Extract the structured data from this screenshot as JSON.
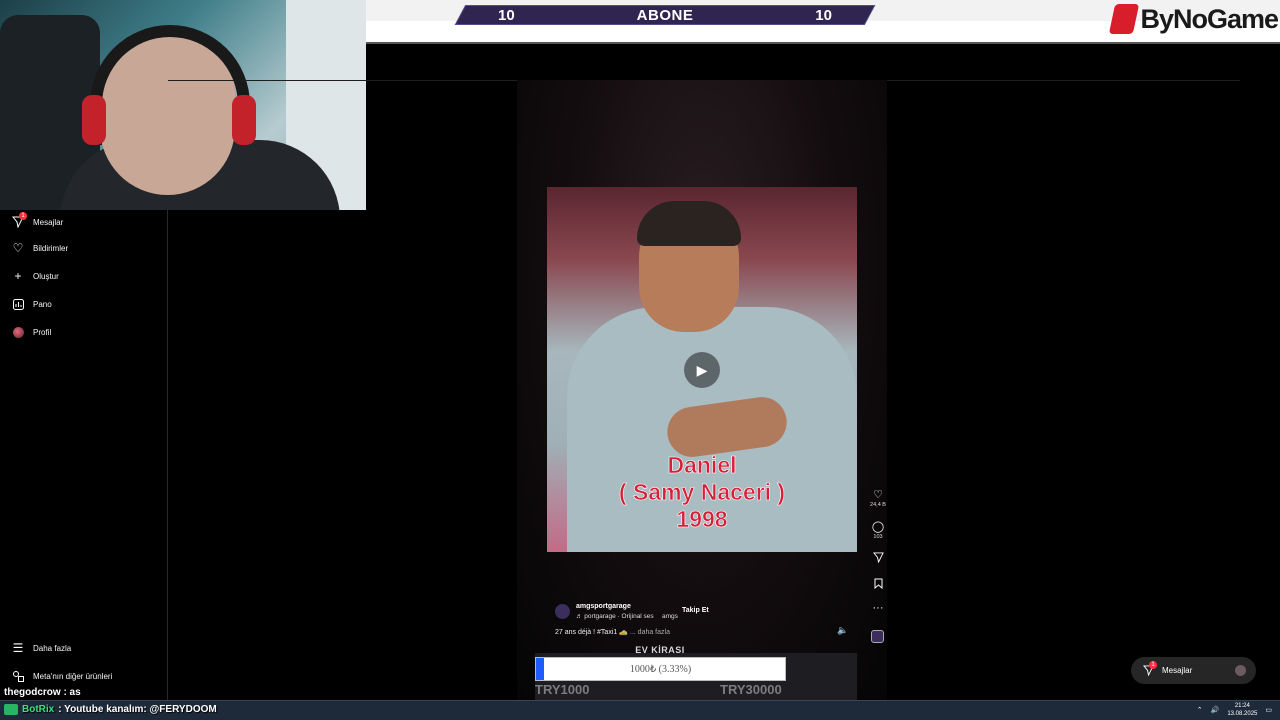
{
  "overlay": {
    "abone": {
      "left_count": "10",
      "title": "ABONE",
      "right_count": "10"
    },
    "logo_text": "ByNoGame"
  },
  "sidebar": {
    "items": [
      {
        "label": "Mesajlar",
        "icon": "messenger-icon",
        "badge": "1"
      },
      {
        "label": "Bildirimler",
        "icon": "heart-icon"
      },
      {
        "label": "Oluştur",
        "icon": "plus-icon"
      },
      {
        "label": "Pano",
        "icon": "dashboard-icon"
      },
      {
        "label": "Profil",
        "icon": "avatar-icon"
      }
    ],
    "more_label": "Daha fazla",
    "meta_label": "Meta'nın diğer ürünleri"
  },
  "post": {
    "caption_line1": "Daniel",
    "caption_line2": "( Samy Naceri )",
    "caption_line3": "1998",
    "author": "amgsportgarage",
    "audio": "♬ portgarage · Orijinal ses",
    "audio_short": "amgs",
    "follow_label": "Takip Et",
    "description": "27 ans déjà ! #Taxi1 🚕",
    "more_label": "... daha fazla",
    "likes": "24,4 B",
    "comments": "103"
  },
  "goal": {
    "title": "EV KİRASI",
    "progress_text": "1000₺ (3.33%)",
    "progress_fraction": 0.0333,
    "min_label": "TRY1000",
    "max_label": "TRY30000",
    "fill_color": "#1f5cff"
  },
  "messages_pill": {
    "label": "Mesajlar",
    "badge": "1"
  },
  "chat": {
    "line1_user": "thegodcrow",
    "line1_text": ": as",
    "line2_user": "BotRix",
    "line2_text": ": Youtube kanalım: @FERYDOOM"
  },
  "taskbar": {
    "time": "21:24",
    "date": "13.08.2025"
  }
}
